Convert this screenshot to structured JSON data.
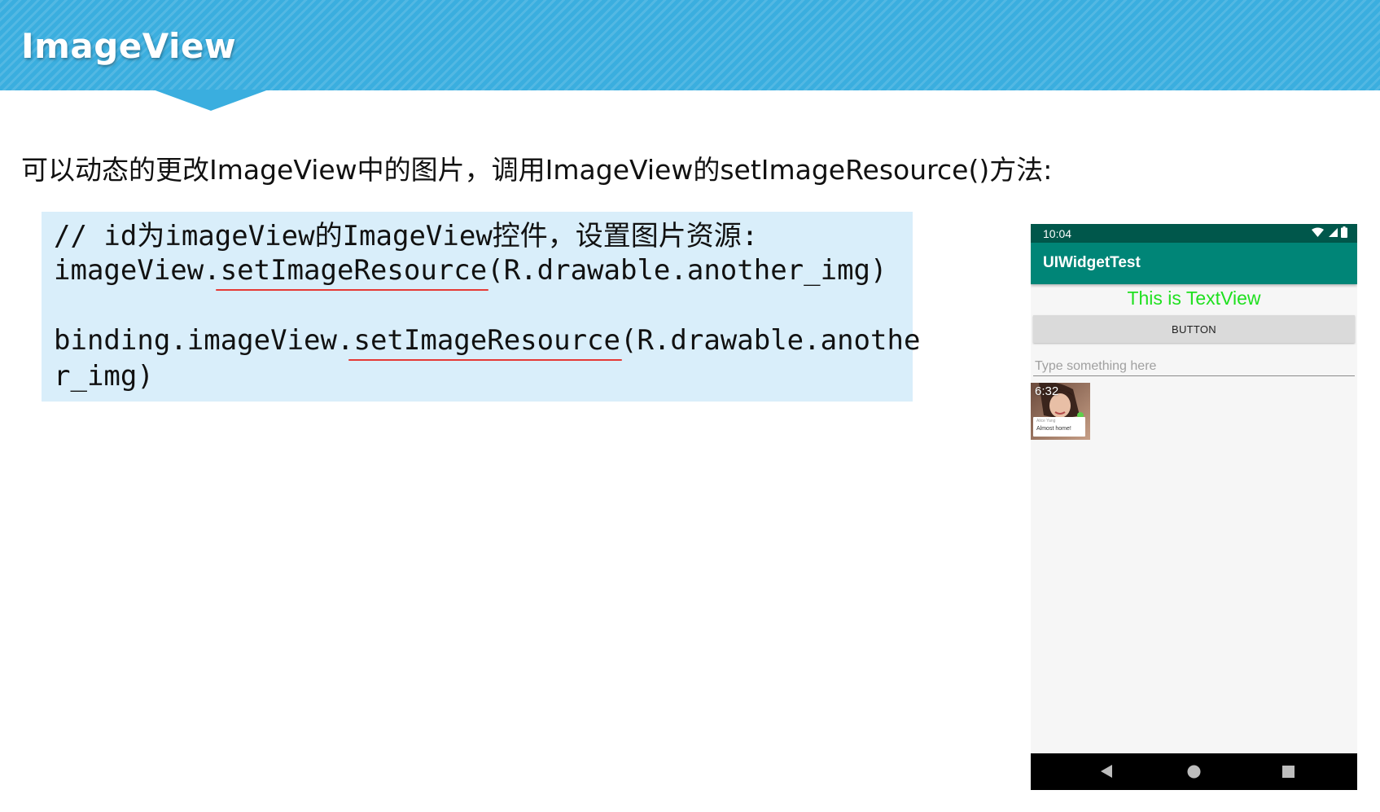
{
  "slide": {
    "title": "ImageView",
    "intro": "可以动态的更改ImageView中的图片，调用ImageView的setImageResource()方法:"
  },
  "code": {
    "line1": "// id为imageView的ImageView控件，设置图片资源:",
    "line2_prefix": "imageView.",
    "line2_method": "setImageResource",
    "line2_suffix": "(R.drawable.another_img)",
    "line3_prefix": "binding.imageView.",
    "line3_method": "setImageResource",
    "line3_suffix": "(R.drawable.anothe",
    "line4": "r_img)"
  },
  "phone": {
    "status_time": "10:04",
    "app_title": "UIWidgetTest",
    "textview": "This is TextView",
    "button": "BUTTON",
    "edit_placeholder": "Type something here",
    "image": {
      "time": "6:32",
      "name": "Alice Yang",
      "message": "Almost home!"
    },
    "colors": {
      "status_bar": "#00574b",
      "app_bar": "#008577",
      "textview": "#1fe01f"
    }
  },
  "colors": {
    "banner": "#3aaedf",
    "code_bg": "#d9eefa",
    "underline": "#e53935"
  },
  "icons": [
    "wifi-icon",
    "signal-icon",
    "battery-icon",
    "back-icon",
    "home-icon",
    "recents-icon"
  ]
}
